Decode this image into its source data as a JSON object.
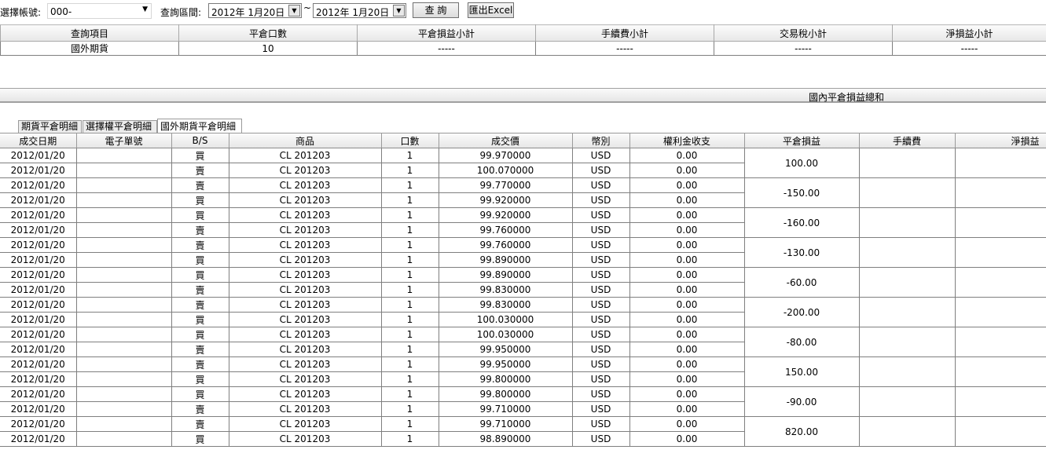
{
  "toolbar": {
    "account_label": "選擇帳號:",
    "account_value": "000-",
    "range_label": "查詢區間:",
    "date_from": "2012年  1月20日",
    "tilde": "~",
    "date_to": "2012年  1月20日",
    "query_button": "查 詢",
    "export_button": "匯出Excel",
    "dropdown_icon": "triangle-down"
  },
  "summary": {
    "headers": [
      "查詢項目",
      "平倉口數",
      "平倉損益小計",
      "手續費小計",
      "交易稅小計",
      "淨損益小計"
    ],
    "row": [
      "國外期貨",
      "10",
      "-----",
      "-----",
      "-----",
      "-----"
    ]
  },
  "domestic_total_label": "國內平倉損益總和",
  "tabs": [
    {
      "label": "期貨平倉明細",
      "active": false
    },
    {
      "label": "選擇權平倉明細",
      "active": false
    },
    {
      "label": "國外期貨平倉明細",
      "active": true
    }
  ],
  "detail": {
    "headers": [
      "成交日期",
      "電子單號",
      "B/S",
      "商品",
      "口數",
      "成交價",
      "幣別",
      "權利金收支",
      "平倉損益",
      "手續費",
      "淨損益"
    ],
    "pairs": [
      {
        "pnl": "100.00",
        "rows": [
          {
            "date": "2012/01/20",
            "order": "",
            "bs": "買",
            "product": "CL 201203",
            "qty": "1",
            "price": "99.970000",
            "currency": "USD",
            "premium": "0.00"
          },
          {
            "date": "2012/01/20",
            "order": "",
            "bs": "賣",
            "product": "CL 201203",
            "qty": "1",
            "price": "100.070000",
            "currency": "USD",
            "premium": "0.00"
          }
        ]
      },
      {
        "pnl": "-150.00",
        "rows": [
          {
            "date": "2012/01/20",
            "order": "",
            "bs": "賣",
            "product": "CL 201203",
            "qty": "1",
            "price": "99.770000",
            "currency": "USD",
            "premium": "0.00"
          },
          {
            "date": "2012/01/20",
            "order": "",
            "bs": "買",
            "product": "CL 201203",
            "qty": "1",
            "price": "99.920000",
            "currency": "USD",
            "premium": "0.00"
          }
        ]
      },
      {
        "pnl": "-160.00",
        "rows": [
          {
            "date": "2012/01/20",
            "order": "",
            "bs": "買",
            "product": "CL 201203",
            "qty": "1",
            "price": "99.920000",
            "currency": "USD",
            "premium": "0.00"
          },
          {
            "date": "2012/01/20",
            "order": "",
            "bs": "賣",
            "product": "CL 201203",
            "qty": "1",
            "price": "99.760000",
            "currency": "USD",
            "premium": "0.00"
          }
        ]
      },
      {
        "pnl": "-130.00",
        "rows": [
          {
            "date": "2012/01/20",
            "order": "",
            "bs": "賣",
            "product": "CL 201203",
            "qty": "1",
            "price": "99.760000",
            "currency": "USD",
            "premium": "0.00"
          },
          {
            "date": "2012/01/20",
            "order": "",
            "bs": "買",
            "product": "CL 201203",
            "qty": "1",
            "price": "99.890000",
            "currency": "USD",
            "premium": "0.00"
          }
        ]
      },
      {
        "pnl": "-60.00",
        "rows": [
          {
            "date": "2012/01/20",
            "order": "",
            "bs": "買",
            "product": "CL 201203",
            "qty": "1",
            "price": "99.890000",
            "currency": "USD",
            "premium": "0.00"
          },
          {
            "date": "2012/01/20",
            "order": "",
            "bs": "賣",
            "product": "CL 201203",
            "qty": "1",
            "price": "99.830000",
            "currency": "USD",
            "premium": "0.00"
          }
        ]
      },
      {
        "pnl": "-200.00",
        "rows": [
          {
            "date": "2012/01/20",
            "order": "",
            "bs": "賣",
            "product": "CL 201203",
            "qty": "1",
            "price": "99.830000",
            "currency": "USD",
            "premium": "0.00"
          },
          {
            "date": "2012/01/20",
            "order": "",
            "bs": "買",
            "product": "CL 201203",
            "qty": "1",
            "price": "100.030000",
            "currency": "USD",
            "premium": "0.00"
          }
        ]
      },
      {
        "pnl": "-80.00",
        "rows": [
          {
            "date": "2012/01/20",
            "order": "",
            "bs": "買",
            "product": "CL 201203",
            "qty": "1",
            "price": "100.030000",
            "currency": "USD",
            "premium": "0.00"
          },
          {
            "date": "2012/01/20",
            "order": "",
            "bs": "賣",
            "product": "CL 201203",
            "qty": "1",
            "price": "99.950000",
            "currency": "USD",
            "premium": "0.00"
          }
        ]
      },
      {
        "pnl": "150.00",
        "rows": [
          {
            "date": "2012/01/20",
            "order": "",
            "bs": "賣",
            "product": "CL 201203",
            "qty": "1",
            "price": "99.950000",
            "currency": "USD",
            "premium": "0.00"
          },
          {
            "date": "2012/01/20",
            "order": "",
            "bs": "買",
            "product": "CL 201203",
            "qty": "1",
            "price": "99.800000",
            "currency": "USD",
            "premium": "0.00"
          }
        ]
      },
      {
        "pnl": "-90.00",
        "rows": [
          {
            "date": "2012/01/20",
            "order": "",
            "bs": "買",
            "product": "CL 201203",
            "qty": "1",
            "price": "99.800000",
            "currency": "USD",
            "premium": "0.00"
          },
          {
            "date": "2012/01/20",
            "order": "",
            "bs": "賣",
            "product": "CL 201203",
            "qty": "1",
            "price": "99.710000",
            "currency": "USD",
            "premium": "0.00"
          }
        ]
      },
      {
        "pnl": "820.00",
        "rows": [
          {
            "date": "2012/01/20",
            "order": "",
            "bs": "賣",
            "product": "CL 201203",
            "qty": "1",
            "price": "99.710000",
            "currency": "USD",
            "premium": "0.00"
          },
          {
            "date": "2012/01/20",
            "order": "",
            "bs": "買",
            "product": "CL 201203",
            "qty": "1",
            "price": "98.890000",
            "currency": "USD",
            "premium": "0.00"
          }
        ]
      }
    ]
  }
}
